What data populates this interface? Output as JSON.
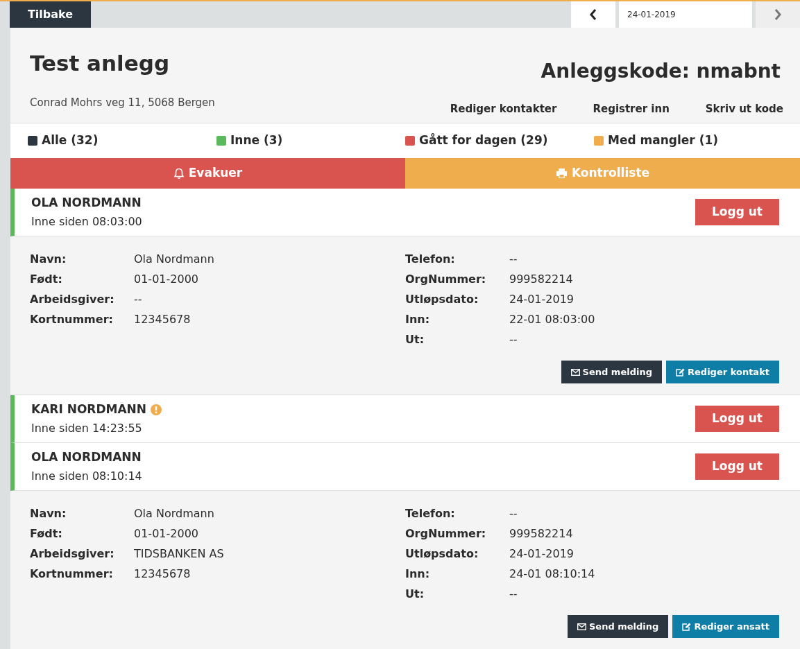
{
  "top_bar": {
    "back_button": "Tilbake",
    "date": "24-01-2019"
  },
  "site": {
    "title": "Test anlegg",
    "address": "Conrad Mohrs veg 11, 5068 Bergen",
    "code_label": "Anleggskode:",
    "code": "nmabnt",
    "links": [
      "Rediger kontakter",
      "Registrer inn",
      "Skriv ut kode"
    ]
  },
  "legend": [
    {
      "label": "Alle (32)",
      "color": "#2b3640"
    },
    {
      "label": "Inne (3)",
      "color": "#5cb85c"
    },
    {
      "label": "Gått for dagen (29)",
      "color": "#d9534f"
    },
    {
      "label": "Med mangler (1)",
      "color": "#f0ad4e"
    }
  ],
  "actions": [
    {
      "kind": "evacuate",
      "label": "Evakuer"
    },
    {
      "kind": "checklist",
      "label": "Kontrolliste"
    }
  ],
  "persons": [
    {
      "name": "OLA NORDMANN",
      "since": "Inne siden 08:03:00",
      "warning": false,
      "logout": "Logg ut",
      "left": [
        {
          "label": "Navn:",
          "value": "Ola Nordmann"
        },
        {
          "label": "Født:",
          "value": "01-01-2000"
        },
        {
          "label": "Arbeidsgiver:",
          "value": "--"
        },
        {
          "label": "Kortnummer:",
          "value": "12345678"
        }
      ],
      "right": [
        {
          "label": "Telefon:",
          "value": "--"
        },
        {
          "label": "OrgNummer:",
          "value": "999582214"
        },
        {
          "label": "Utløpsdato:",
          "value": "24-01-2019"
        },
        {
          "label": "Inn:",
          "value": "22-01 08:03:00"
        },
        {
          "label": "Ut:",
          "value": "--"
        }
      ],
      "buttons": [
        {
          "kind": "message",
          "label": "Send melding"
        },
        {
          "kind": "edit",
          "label": "Rediger kontakt"
        }
      ]
    },
    {
      "name": "KARI NORDMANN",
      "since": "Inne siden 14:23:55",
      "warning": true,
      "logout": "Logg ut"
    },
    {
      "name": "OLA NORDMANN",
      "since": "Inne siden 08:10:14",
      "warning": false,
      "logout": "Logg ut",
      "left": [
        {
          "label": "Navn:",
          "value": "Ola Nordmann"
        },
        {
          "label": "Født:",
          "value": "01-01-2000"
        },
        {
          "label": "Arbeidsgiver:",
          "value": "TIDSBANKEN AS"
        },
        {
          "label": "Kortnummer:",
          "value": "12345678"
        }
      ],
      "right": [
        {
          "label": "Telefon:",
          "value": "--"
        },
        {
          "label": "OrgNummer:",
          "value": "999582214"
        },
        {
          "label": "Utløpsdato:",
          "value": "24-01-2019"
        },
        {
          "label": "Inn:",
          "value": "24-01 08:10:14"
        },
        {
          "label": "Ut:",
          "value": "--"
        }
      ],
      "buttons": [
        {
          "kind": "message",
          "label": "Send melding"
        },
        {
          "kind": "edit",
          "label": "Rediger ansatt"
        }
      ]
    }
  ]
}
